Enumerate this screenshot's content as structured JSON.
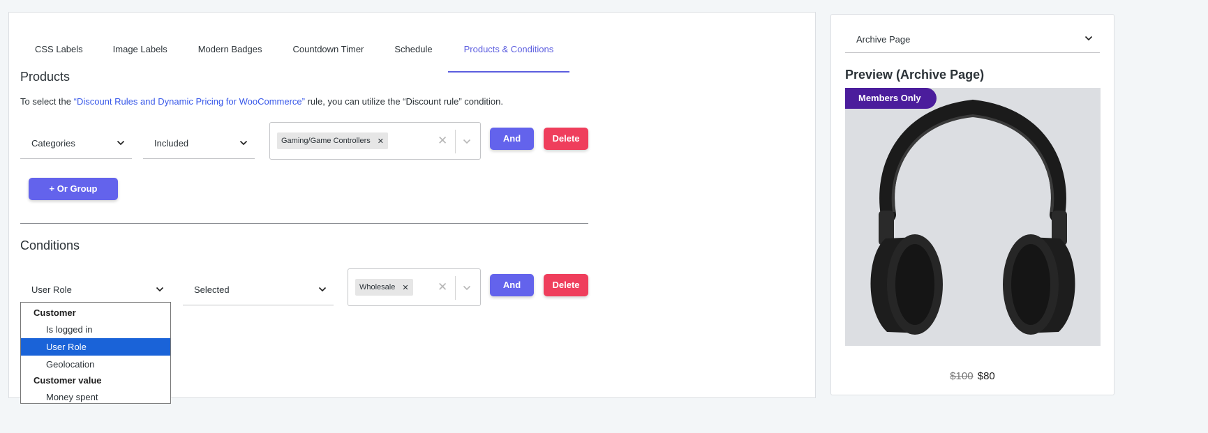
{
  "tabs": [
    {
      "label": "CSS Labels"
    },
    {
      "label": "Image Labels"
    },
    {
      "label": "Modern Badges"
    },
    {
      "label": "Countdown Timer"
    },
    {
      "label": "Schedule"
    },
    {
      "label": "Products & Conditions",
      "active": true
    }
  ],
  "products": {
    "title": "Products",
    "note_prefix": "To select the ",
    "note_link": "“Discount Rules and Dynamic Pricing for WooCommerce”",
    "note_suffix": " rule, you can utilize the “Discount rule” condition.",
    "field": "Categories",
    "operator": "Included",
    "tags": [
      "Gaming/Game Controllers"
    ],
    "and_label": "And",
    "delete_label": "Delete",
    "or_group_label": "+ Or Group"
  },
  "conditions": {
    "title": "Conditions",
    "field": "User Role",
    "operator": "Selected",
    "tags": [
      "Wholesale"
    ],
    "and_label": "And",
    "delete_label": "Delete",
    "dropdown": {
      "groups": [
        {
          "label": "Customer",
          "options": [
            "Is logged in",
            "User Role",
            "Geolocation"
          ]
        },
        {
          "label": "Customer value",
          "options": [
            "Money spent"
          ]
        }
      ],
      "selected": "User Role"
    }
  },
  "preview": {
    "page_select": "Archive Page",
    "title": "Preview (Archive Page)",
    "badge": "Members Only",
    "old_price": "$100",
    "new_price": "$80",
    "badge_color": "#4b1d9c",
    "product_image": "headphones"
  },
  "colors": {
    "accent": "#5b5ddf",
    "and_button": "#6363ec",
    "delete_button": "#ef3e5c",
    "dropdown_selected": "#1a63d8"
  }
}
